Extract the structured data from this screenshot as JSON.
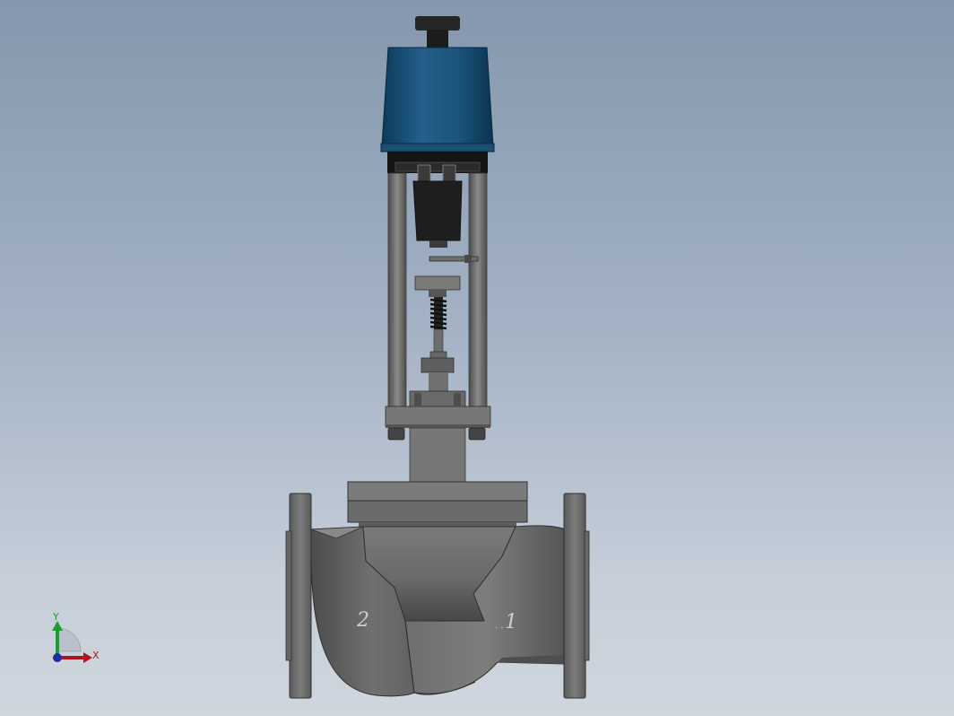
{
  "viewport": {
    "background_top": "#8597ad",
    "background_bottom": "#cfd6de"
  },
  "model": {
    "actuator_color": "#1f5b86",
    "body_color": "#6c6c6c",
    "port_labels": {
      "outlet": "2",
      "inlet": "1"
    }
  },
  "triad": {
    "y_label": "Y",
    "x_label": "X",
    "y_color": "#1f9c2f",
    "x_color": "#b0151c",
    "z_color": "#1d2f9c"
  }
}
